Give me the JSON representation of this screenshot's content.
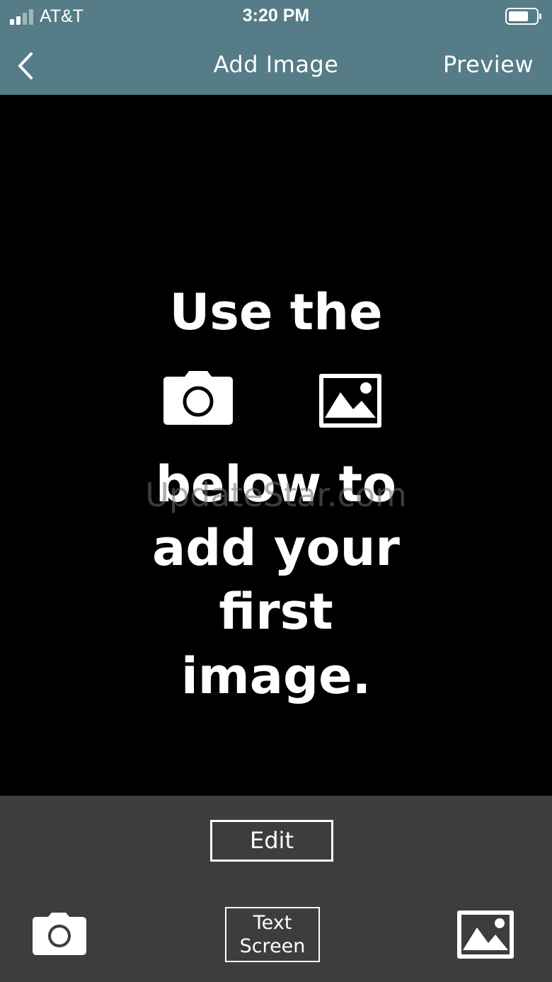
{
  "status_bar": {
    "carrier": "AT&T",
    "time": "3:20 PM",
    "signal_icon": "signal-icon",
    "battery_icon": "battery-icon"
  },
  "nav": {
    "back_icon": "chevron-left-icon",
    "title": "Add Image",
    "preview_label": "Preview"
  },
  "main": {
    "line1": "Use the",
    "line2": "below to",
    "line3": "add your",
    "line4": "first",
    "line5": "image.",
    "camera_icon": "camera-icon",
    "gallery_icon": "image-icon",
    "watermark": "UpdateStar.com"
  },
  "toolbar": {
    "edit_label": "Edit",
    "text_screen_line1": "Text",
    "text_screen_line2": "Screen",
    "camera_icon": "camera-icon",
    "gallery_icon": "image-icon"
  },
  "colors": {
    "header": "#557c87",
    "toolbar": "#3d3d3d",
    "canvas": "#000000",
    "foreground": "#ffffff"
  }
}
